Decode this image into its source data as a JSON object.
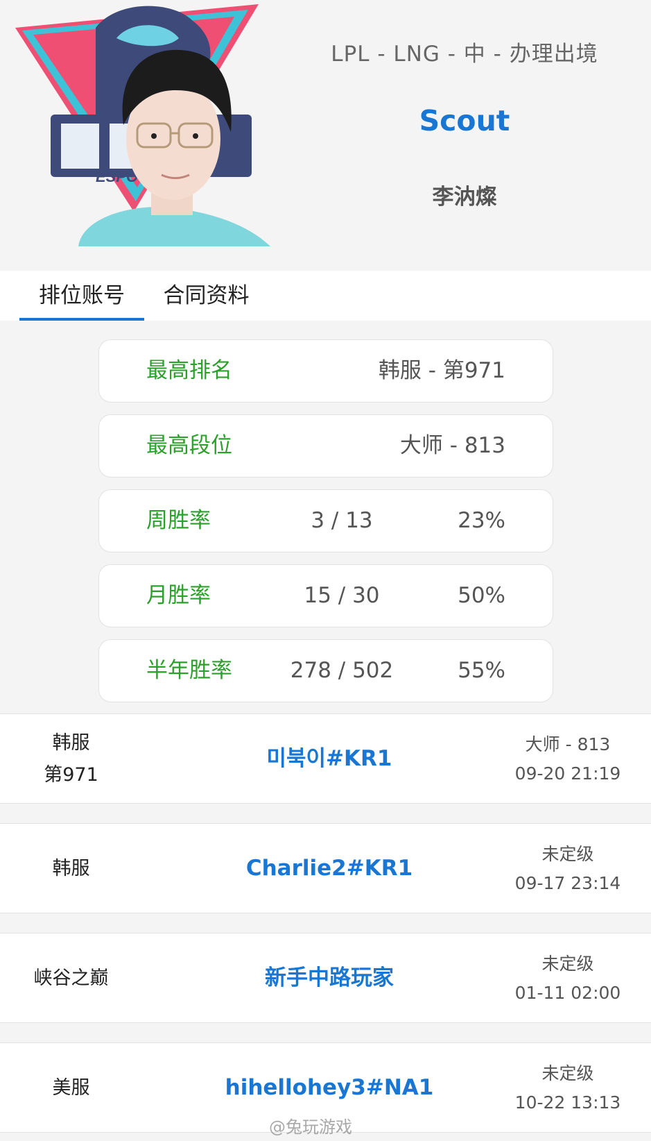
{
  "header": {
    "meta": "LPL - LNG - 中 - 办理出境",
    "player_name": "Scout",
    "real_name": "李汭燦",
    "team_logo_text": "ESPO"
  },
  "tabs": [
    {
      "label": "排位账号",
      "active": true
    },
    {
      "label": "合同资料",
      "active": false
    }
  ],
  "stats": {
    "highest_rank": {
      "label": "最高排名",
      "value": "韩服 - 第971"
    },
    "highest_tier": {
      "label": "最高段位",
      "value": "大师 - 813"
    },
    "weekly": {
      "label": "周胜率",
      "record": "3 / 13",
      "rate": "23%"
    },
    "monthly": {
      "label": "月胜率",
      "record": "15 / 30",
      "rate": "50%"
    },
    "half_year": {
      "label": "半年胜率",
      "record": "278 / 502",
      "rate": "55%"
    }
  },
  "accounts": [
    {
      "server": "韩服",
      "server_rank": "第971",
      "name": "미북이#KR1",
      "tier": "大师 - 813",
      "time": "09-20 21:19"
    },
    {
      "server": "韩服",
      "server_rank": "",
      "name": "Charlie2#KR1",
      "tier": "未定级",
      "time": "09-17 23:14"
    },
    {
      "server": "峡谷之巅",
      "server_rank": "",
      "name": "新手中路玩家",
      "tier": "未定级",
      "time": "01-11 02:00"
    },
    {
      "server": "美服",
      "server_rank": "",
      "name": "hihellohey3#NA1",
      "tier": "未定级",
      "time": "10-22 13:13"
    }
  ],
  "watermark": "@兔玩游戏",
  "colors": {
    "accent_blue": "#1976d2",
    "label_green": "#2ba02b",
    "logo_pink": "#ef4f73",
    "logo_cyan": "#3ec2d8",
    "jersey": "#7fd6dc"
  }
}
